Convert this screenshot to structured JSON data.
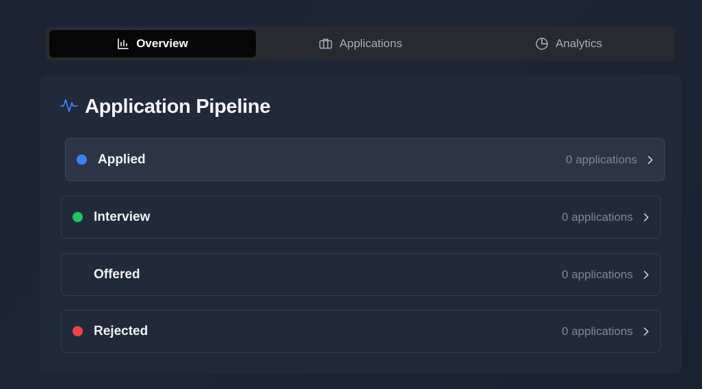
{
  "tabs": [
    {
      "label": "Overview",
      "icon": "bar-chart-icon",
      "active": true
    },
    {
      "label": "Applications",
      "icon": "briefcase-icon",
      "active": false
    },
    {
      "label": "Analytics",
      "icon": "pie-chart-icon",
      "active": false
    }
  ],
  "pipeline": {
    "title": "Application Pipeline",
    "icon": "activity-icon",
    "accent": "#3b82f6",
    "stages": [
      {
        "label": "Applied",
        "count": "0 applications",
        "color": "#3b82f6"
      },
      {
        "label": "Interview",
        "count": "0 applications",
        "color": "#22c55e"
      },
      {
        "label": "Offered",
        "count": "0 applications",
        "color": ""
      },
      {
        "label": "Rejected",
        "count": "0 applications",
        "color": "#ef4444"
      }
    ]
  }
}
